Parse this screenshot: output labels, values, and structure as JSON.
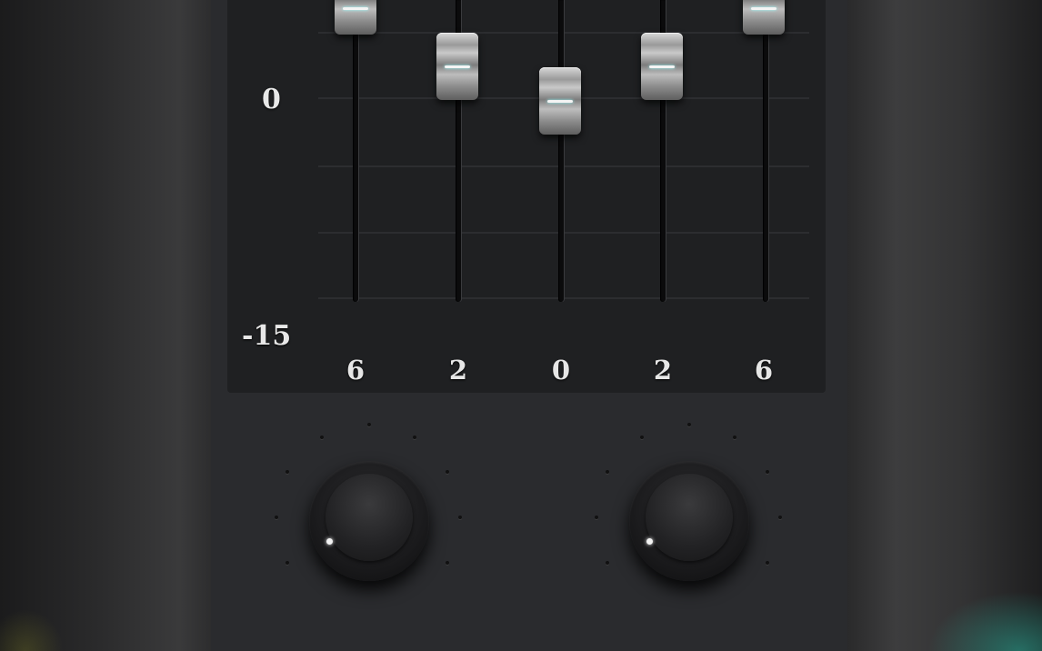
{
  "equalizer": {
    "scale": {
      "top_label": "0",
      "bottom_label": "-15"
    },
    "bands": [
      {
        "label": "6"
      },
      {
        "label": "2"
      },
      {
        "label": "0"
      },
      {
        "label": "2"
      },
      {
        "label": "6"
      }
    ]
  },
  "knobs": [
    {
      "name": "left-knob"
    },
    {
      "name": "right-knob"
    }
  ],
  "colors": {
    "panel": "#1f2022",
    "body": "#2a2b2e",
    "accent_glow": "#28aa96"
  },
  "icons": [
    "fader-thumb",
    "rotary-knob"
  ]
}
